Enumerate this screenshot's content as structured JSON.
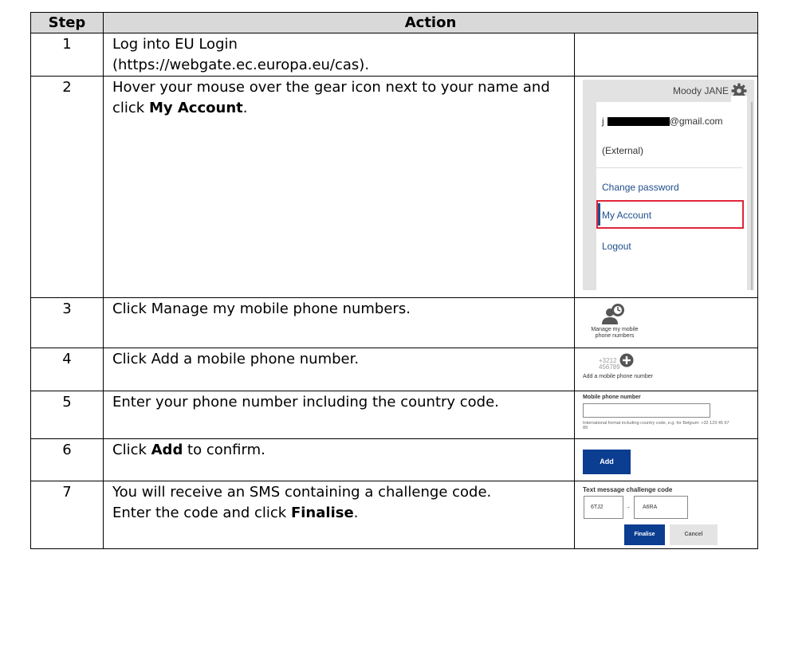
{
  "table": {
    "headers": {
      "step": "Step",
      "action": "Action"
    },
    "rows": [
      {
        "step": "1",
        "text": [
          "Log into EU Login",
          "(https://webgate.ec.europa.eu/cas)."
        ]
      },
      {
        "step": "2",
        "pre": "Hover your mouse over the gear icon next to your name and click ",
        "bold": "My Account",
        "post": "."
      },
      {
        "step": "3",
        "text": [
          "Click Manage my mobile phone numbers."
        ]
      },
      {
        "step": "4",
        "text": [
          "Click Add a mobile phone number."
        ]
      },
      {
        "step": "5",
        "text": [
          "Enter your phone number including the country code."
        ]
      },
      {
        "step": "6",
        "pre": "Click ",
        "bold": "Add",
        "post": " to confirm."
      },
      {
        "step": "7",
        "line1": "You will receive an SMS containing a challenge code.",
        "pre": "Enter the code and click ",
        "bold": "Finalise",
        "post": "."
      }
    ]
  },
  "screens": {
    "account_menu": {
      "user_name": "Moody JANE",
      "email_prefix": "j",
      "email_suffix": "@gmail.com",
      "user_type": "(External)",
      "items": [
        "Change password",
        "My Account",
        "Logout"
      ],
      "highlight_color": "#e0263a",
      "icon": "gear-icon"
    },
    "manage_mobile": {
      "caption_line1": "Manage my mobile",
      "caption_line2": "phone numbers",
      "icon": "mobile-users-icon"
    },
    "add_mobile": {
      "numbers_line1": "+3212",
      "numbers_line2": "456789",
      "caption": "Add a mobile phone number",
      "icon": "plus-circle-icon"
    },
    "phone_field": {
      "label": "Mobile phone number",
      "hint": "International format including country code, e.g. for Belgium: +32 123 45 67 89"
    },
    "add_button": {
      "label": "Add",
      "color": "#0b3d91"
    },
    "challenge": {
      "label": "Text message challenge code",
      "part1": "6TJ2",
      "separator": "-",
      "part2": "A6RA",
      "finalise_label": "Finalise",
      "cancel_label": "Cancel"
    }
  }
}
